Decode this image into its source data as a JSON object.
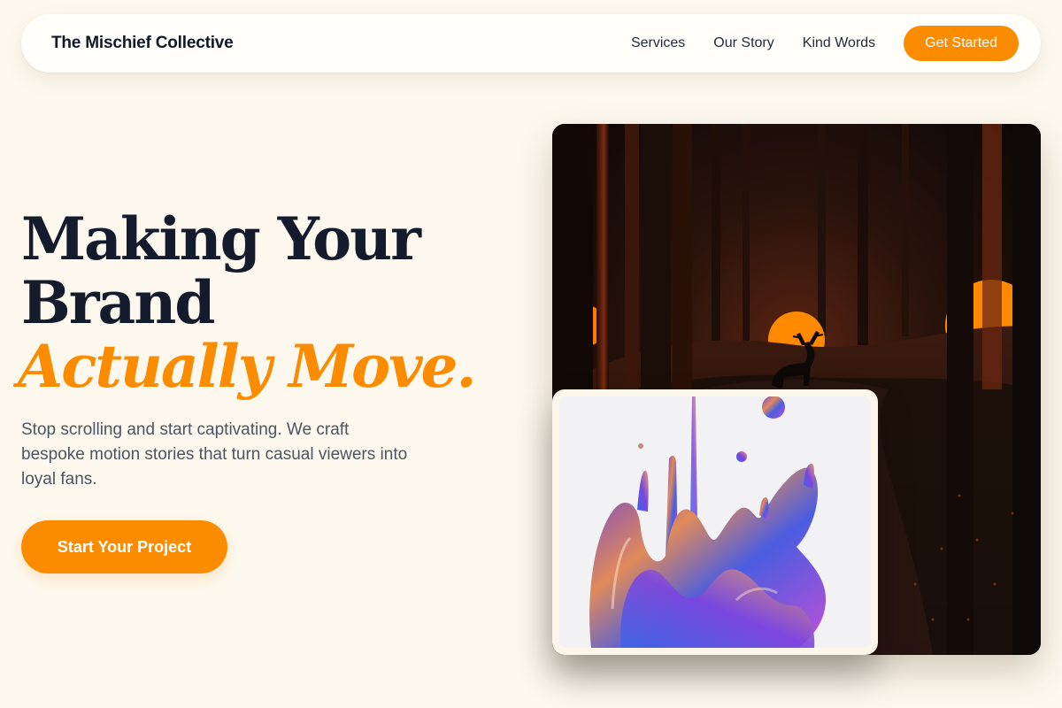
{
  "nav": {
    "brand": "The Mischief Collective",
    "links": [
      "Services",
      "Our Story",
      "Kind Words"
    ],
    "cta_label": "Get Started"
  },
  "hero": {
    "title_line1": "Making Your",
    "title_line2": "Brand",
    "title_accent": "Actually Move.",
    "subtitle": "Stop scrolling and start captivating. We craft bespoke motion stories that turn casual viewers into loyal fans.",
    "cta_label": "Start Your Project"
  },
  "media": {
    "primary_image": "dark-forest-deer-sunset-image",
    "secondary_image": "iridescent-liquid-splash-image"
  },
  "colors": {
    "background": "#fdf8ee",
    "accent": "#fb8c00",
    "heading": "#141b2d",
    "body_text": "#4b5563"
  }
}
